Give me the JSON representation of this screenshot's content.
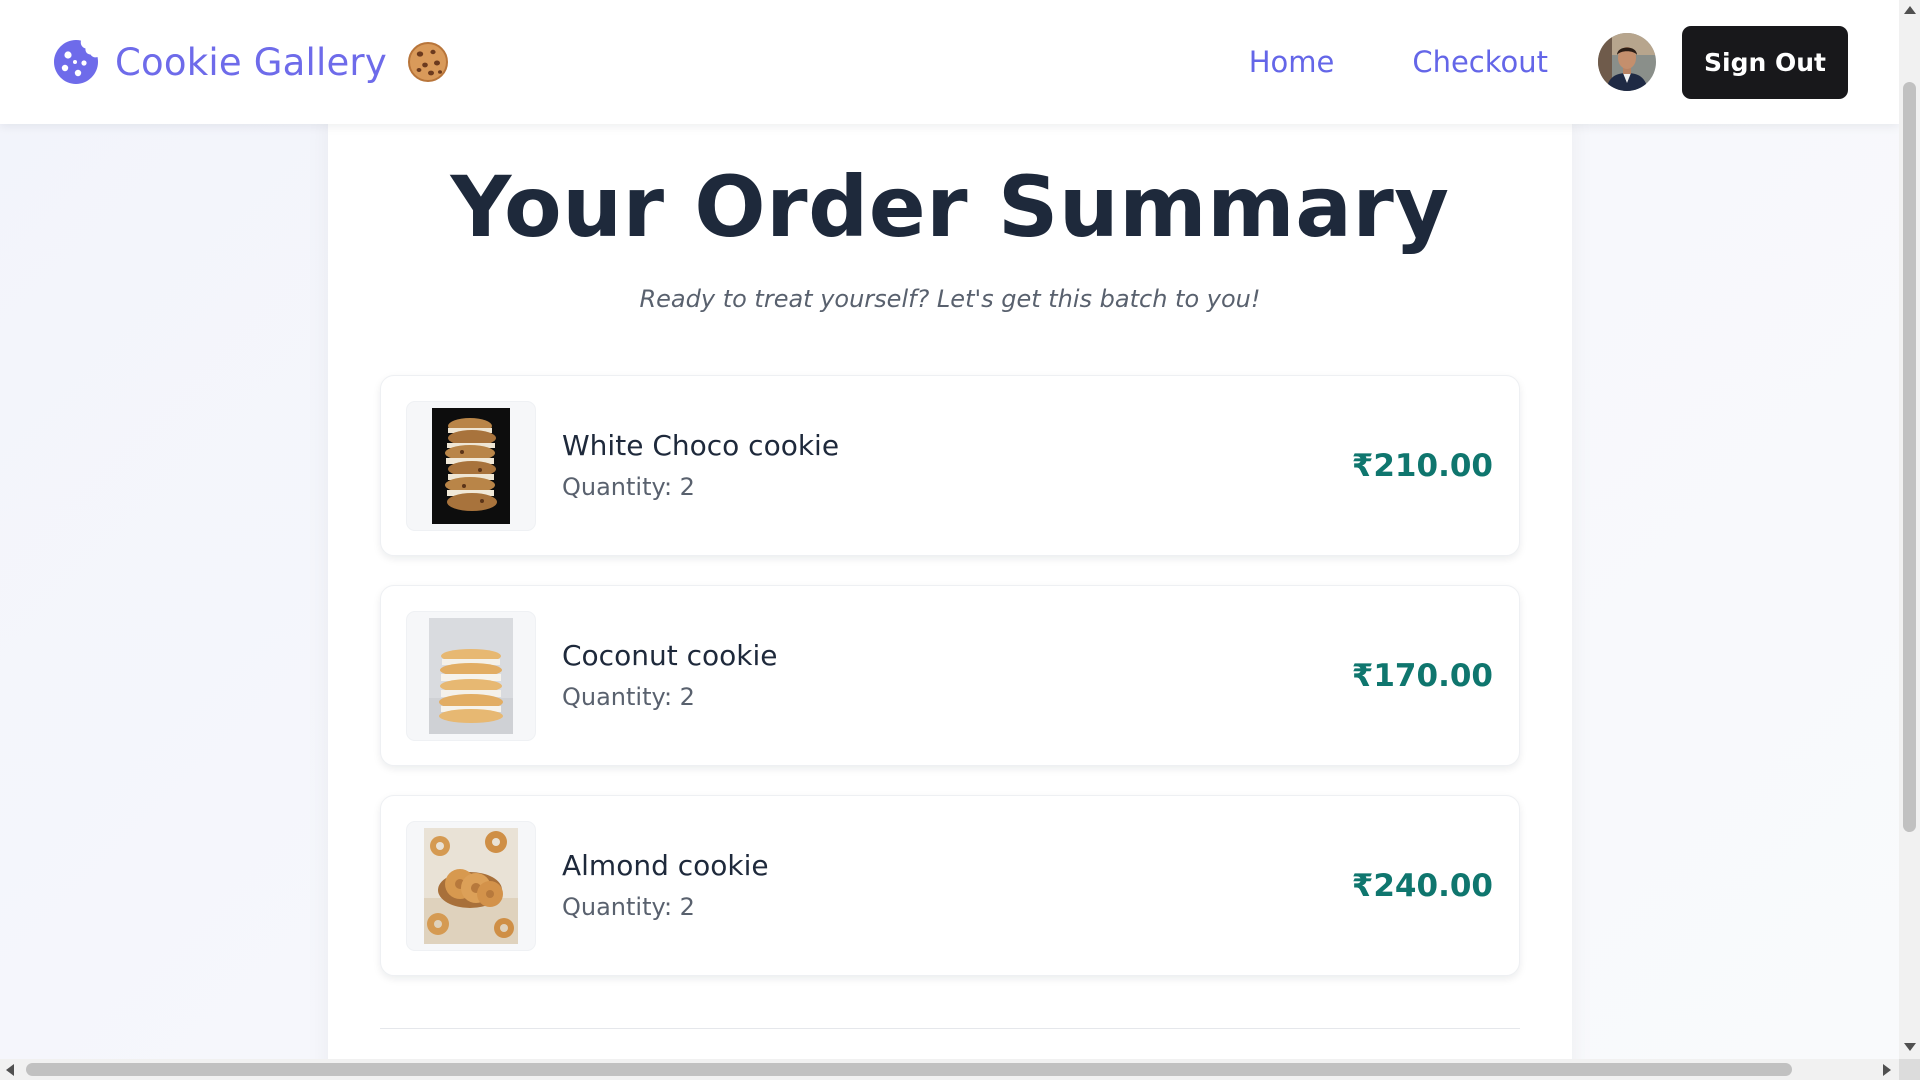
{
  "navbar": {
    "brand": "Cookie Gallery",
    "brand_color": "#6e6bea",
    "links": [
      {
        "label": "Home"
      },
      {
        "label": "Checkout"
      }
    ],
    "signout_label": "Sign Out"
  },
  "page": {
    "title": "Your Order Summary",
    "subtitle": "Ready to treat yourself? Let's get this batch to you!"
  },
  "items": [
    {
      "name": "White Choco cookie",
      "quantity": "Quantity: 2",
      "price": "₹210.00",
      "image": "stacked-sandwich-cookies-dark"
    },
    {
      "name": "Coconut cookie",
      "quantity": "Quantity: 2",
      "price": "₹170.00",
      "image": "stacked-coconut-cookies"
    },
    {
      "name": "Almond cookie",
      "quantity": "Quantity: 2",
      "price": "₹240.00",
      "image": "ring-cookies"
    }
  ],
  "colors": {
    "price": "#0f766e",
    "title": "#1e293b",
    "signout_bg": "#18181b"
  }
}
